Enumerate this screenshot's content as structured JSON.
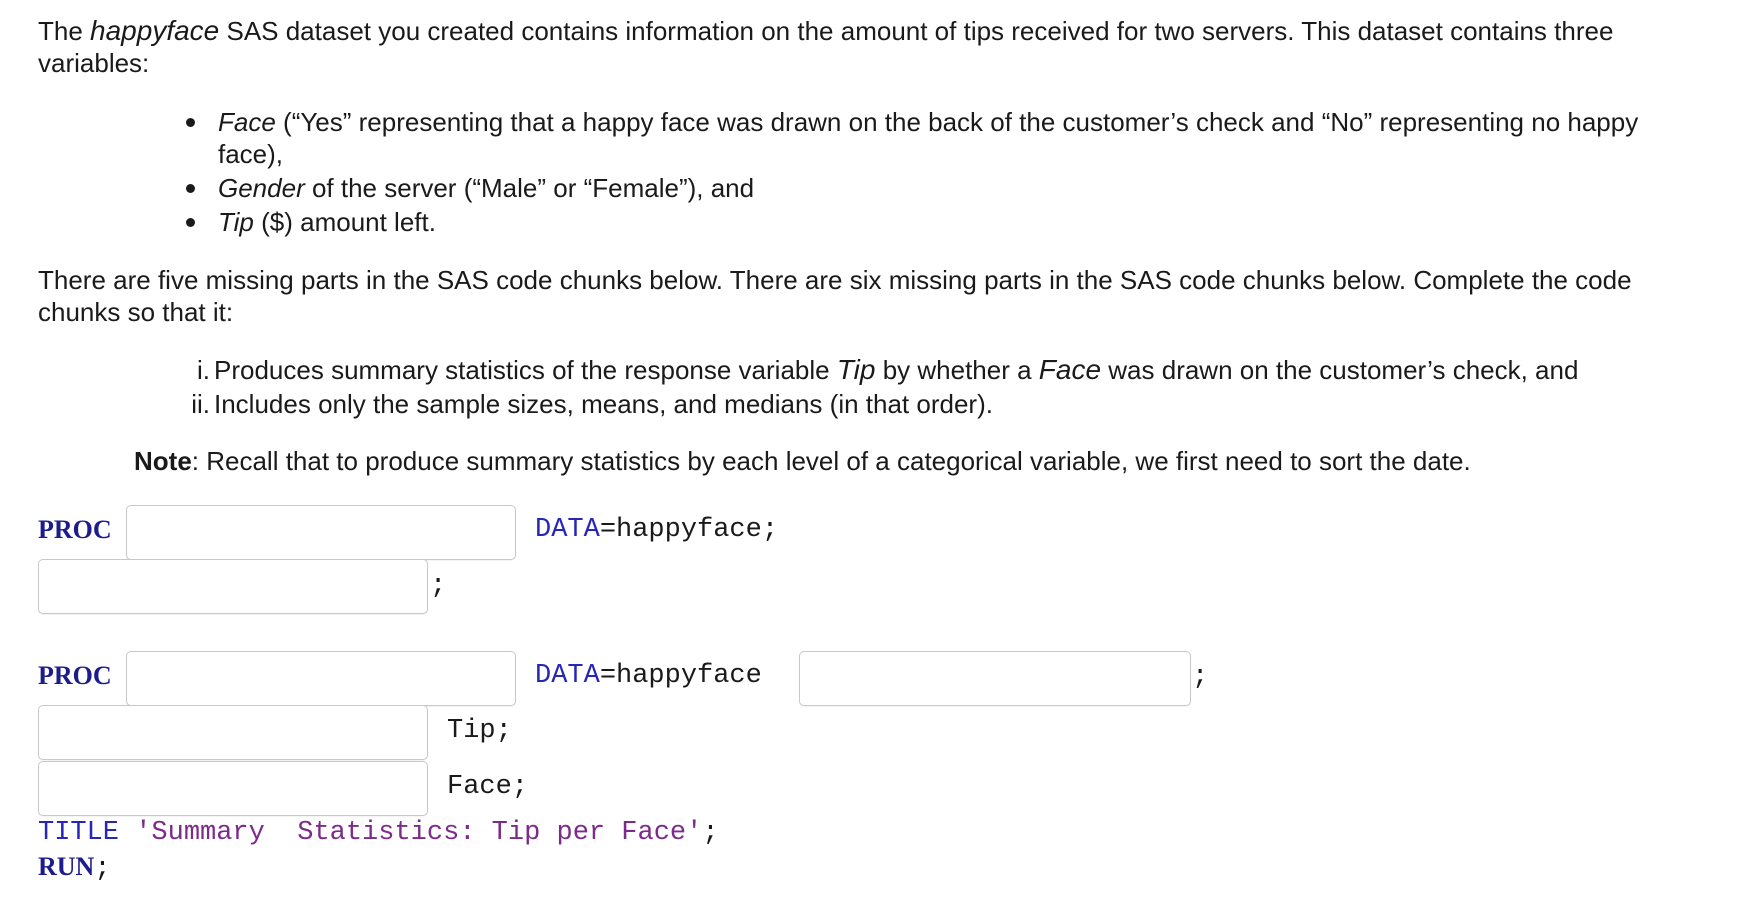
{
  "intro": {
    "part1": "The ",
    "dataset": "happyface",
    "part2": " SAS dataset you created contains information on the amount of tips received for two servers.  This dataset contains three variables:"
  },
  "bullets": [
    {
      "name": "Face",
      "text": " (“Yes” representing that a happy face was drawn on the back of the customer’s check and “No” representing no happy face),"
    },
    {
      "name": "Gender",
      "text": " of the server (“Male” or “Female”), and"
    },
    {
      "name": "Tip",
      "text": " ($) amount left."
    }
  ],
  "para2": "There are five missing parts in the SAS code chunks below. There are six missing parts in the SAS code chunks below. Complete the code chunks so that it:",
  "requirements": [
    {
      "num": "i.",
      "pre": "Produces summary statistics of the response variable ",
      "var1": "Tip",
      "mid": " by whether a ",
      "var2": "Face",
      "post": " was drawn on the customer’s check, and"
    },
    {
      "num": "ii.",
      "pre": "Includes only the sample sizes, means, and medians (in that order).",
      "var1": "",
      "mid": "",
      "var2": "",
      "post": ""
    }
  ],
  "note": {
    "label": "Note",
    "text": ": Recall that to produce summary statistics by each level of a categorical variable, we first need to sort the date."
  },
  "code": {
    "proc": "PROC",
    "data_kw": "DATA",
    "data_val1": "=happyface;",
    "data_val2": "=happyface",
    "semicolon": ";",
    "tip": "Tip;",
    "face": "Face;",
    "title_kw": "TITLE",
    "title_str": "'Summary  Statistics: Tip per Face'",
    "run_kw": "RUN",
    "blanks": [
      "",
      "",
      "",
      "",
      "",
      ""
    ]
  }
}
